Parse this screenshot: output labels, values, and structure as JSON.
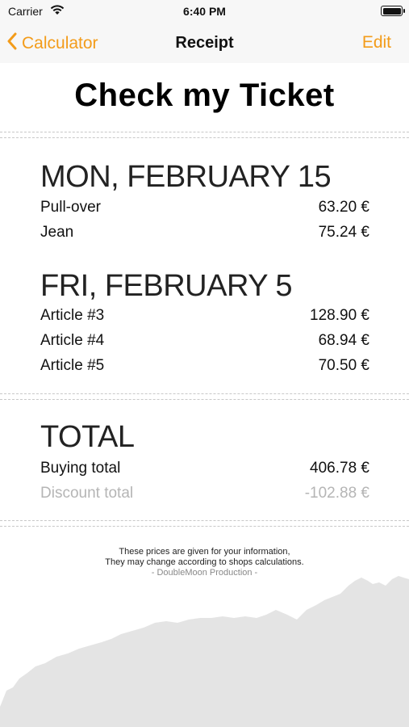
{
  "status_bar": {
    "carrier": "Carrier",
    "time": "6:40 PM"
  },
  "nav": {
    "back_label": "Calculator",
    "title": "Receipt",
    "edit_label": "Edit",
    "accent_color": "#F39C1A"
  },
  "receipt": {
    "title": "Check my Ticket",
    "groups": [
      {
        "date": "MON, FEBRUARY 15",
        "items": [
          {
            "name": "Pull-over",
            "price": "63.20 €"
          },
          {
            "name": "Jean",
            "price": "75.24 €"
          }
        ]
      },
      {
        "date": "FRI, FEBRUARY 5",
        "items": [
          {
            "name": "Article #3",
            "price": "128.90 €"
          },
          {
            "name": "Article #4",
            "price": "68.94 €"
          },
          {
            "name": "Article #5",
            "price": "70.50 €"
          }
        ]
      }
    ],
    "total": {
      "heading": "TOTAL",
      "buying_label": "Buying total",
      "buying_value": "406.78 €",
      "discount_label": "Discount total",
      "discount_value": "-102.88 €"
    },
    "footer": {
      "line1": "These prices are given for your information,",
      "line2": "They may change according to shops calculations.",
      "credit": "- DoubleMoon Production -"
    }
  }
}
